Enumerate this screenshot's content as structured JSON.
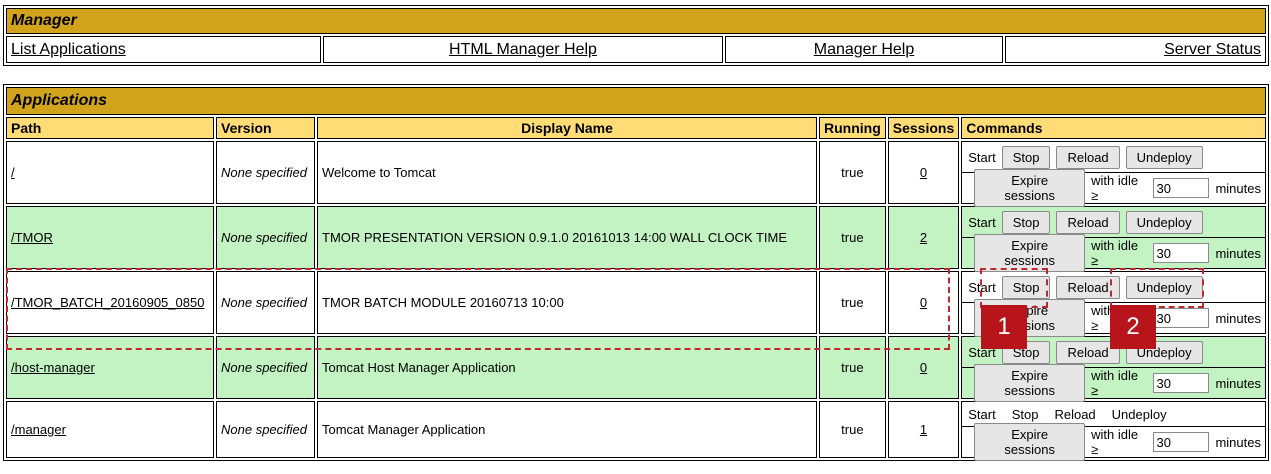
{
  "manager": {
    "title": "Manager",
    "nav": [
      "List Applications",
      "HTML Manager Help",
      "Manager Help",
      "Server Status"
    ]
  },
  "applications": {
    "title": "Applications",
    "headers": {
      "path": "Path",
      "version": "Version",
      "display_name": "Display Name",
      "running": "Running",
      "sessions": "Sessions",
      "commands": "Commands"
    },
    "commands": {
      "start": "Start",
      "stop": "Stop",
      "reload": "Reload",
      "undeploy": "Undeploy",
      "expire": "Expire sessions",
      "with_idle": "with idle ≥",
      "minutes": "minutes"
    },
    "rows": [
      {
        "path": "/",
        "version": "None specified",
        "display_name": "Welcome to Tomcat",
        "running": "true",
        "sessions": "0",
        "idle": "30"
      },
      {
        "path": "/TMOR",
        "version": "None specified",
        "display_name": "TMOR PRESENTATION VERSION 0.9.1.0 20161013 14:00 WALL CLOCK TIME",
        "running": "true",
        "sessions": "2",
        "idle": "30"
      },
      {
        "path": "/TMOR_BATCH_20160905_0850",
        "version": "None specified",
        "display_name": "TMOR BATCH MODULE 20160713 10:00",
        "running": "true",
        "sessions": "0",
        "idle": "30"
      },
      {
        "path": "/host-manager",
        "version": "None specified",
        "display_name": "Tomcat Host Manager Application",
        "running": "true",
        "sessions": "0",
        "idle": "30"
      },
      {
        "path": "/manager",
        "version": "None specified",
        "display_name": "Tomcat Manager Application",
        "running": "true",
        "sessions": "1",
        "idle": "30"
      }
    ]
  },
  "annotations": {
    "badge_1": "1",
    "badge_2": "2",
    "highlight_color": "#c0282e"
  }
}
